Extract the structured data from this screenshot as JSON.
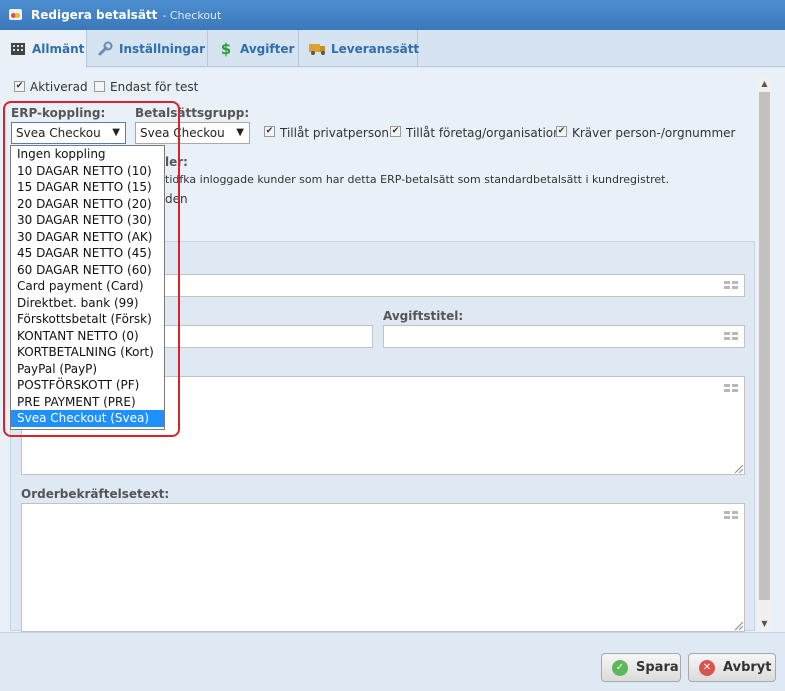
{
  "window": {
    "title": "Redigera betalsätt",
    "subtitle": "- Checkout"
  },
  "tabs": [
    {
      "label": "Allmänt",
      "icon": "grid-icon",
      "active": true
    },
    {
      "label": "Inställningar",
      "icon": "wrench-icon",
      "active": false
    },
    {
      "label": "Avgifter",
      "icon": "dollar-icon",
      "active": false
    },
    {
      "label": "Leveranssätt",
      "icon": "truck-icon",
      "active": false
    }
  ],
  "general": {
    "aktiverad_label": "Aktiverad",
    "aktiverad_checked": true,
    "endast_test_label": "Endast för test",
    "endast_test_checked": false
  },
  "erp": {
    "label": "ERP-koppling:",
    "selected": "Svea Checkou",
    "options": [
      "Ingen koppling",
      "10 DAGAR NETTO (10)",
      "15 DAGAR NETTO (15)",
      "20 DAGAR NETTO (20)",
      "30 DAGAR NETTO (30)",
      "30 DAGAR NETTO (AK)",
      "45 DAGAR NETTO (45)",
      "60 DAGAR NETTO (60)",
      "Card payment (Card)",
      "Direktbet. bank (99)",
      "Förskottsbetalt (Försk)",
      "KONTANT NETTO (0)",
      "KORTBETALNING (Kort)",
      "PayPal (PayP)",
      "POSTFÖRSKOTT (PF)",
      "PRE PAYMENT (PRE)",
      "Svea Checkout (Svea)"
    ],
    "selected_index": 16
  },
  "group": {
    "label": "Betalsättsgrupp:",
    "selected": "Svea Checkou"
  },
  "permissions": {
    "privat_label": "Tillåt privatperson",
    "privat_checked": true,
    "foretag_label": "Tillåt företag/organisation",
    "foretag_checked": true,
    "kraver_label": "Kräver person-/orgnummer",
    "kraver_checked": true
  },
  "partial": {
    "heading_fragment": "ler:",
    "desc_fragment": "tidfka inloggade kunder som har detta ERP-betalsätt som standardbetalsätt i kundregistret.",
    "line_fragment": "den"
  },
  "fields": {
    "avgiftstitel_label": "Avgiftstitel:",
    "orderbekraftelse_label": "Orderbekräftelsetext:"
  },
  "footer": {
    "save_label": "Spara",
    "cancel_label": "Avbryt"
  },
  "colors": {
    "accent": "#3a78ba",
    "selection": "#1e90ff",
    "highlight": "#d9222a"
  }
}
